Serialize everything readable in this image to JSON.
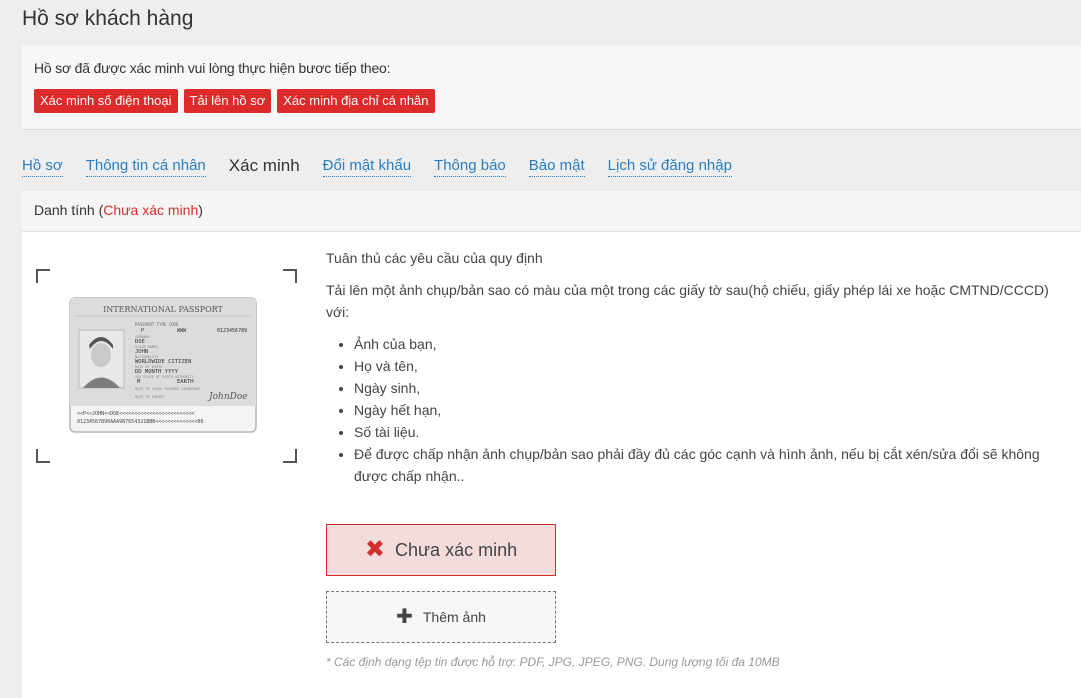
{
  "page": {
    "title": "Hồ sơ khách hàng"
  },
  "notice": {
    "text": "Hồ sơ đã được xác minh vui lòng thực hiện bươc tiếp theo:",
    "buttons": [
      {
        "label": "Xác minh số điện thoại"
      },
      {
        "label": "Tải lên hồ sơ"
      },
      {
        "label": "Xác minh địa chỉ cá nhân"
      }
    ]
  },
  "tabs": [
    {
      "label": "Hồ sơ"
    },
    {
      "label": "Thông tin cá nhân"
    },
    {
      "label": "Xác minh",
      "active": true
    },
    {
      "label": "Đổi mật khẩu"
    },
    {
      "label": "Thông báo"
    },
    {
      "label": "Bảo mật"
    },
    {
      "label": "Lịch sử đăng nhập"
    }
  ],
  "panel": {
    "header_label": "Danh tính",
    "header_status": "Chưa xác minh"
  },
  "passport": {
    "title": "INTERNATIONAL PASSPORT",
    "surname": "DOE",
    "given_name": "JOHN",
    "nationality": "WORLDWIDE CITIZEN",
    "dob": "DD MONTH YYYY",
    "sex": "M",
    "place_of_birth": "EARTH",
    "code": "WWW",
    "number": "0123456789",
    "signature": "JohnDoe",
    "mrz1": "<<P<<JOHN<<DOE<<<<<<<<<<<<<<<<<<<<<<<<<",
    "mrz2": "01234567890AAA987654321BBB<<<<<<<<<<<<<<00"
  },
  "requirements": {
    "title": "Tuân thủ các yêu cầu của quy định",
    "desc": "Tải lên một ảnh chụp/bản sao có màu của một trong các giấy tờ sau(hộ chiếu, giấy phép lái xe hoặc CMTND/CCCD) với:",
    "items": [
      "Ảnh của bạn,",
      "Họ và tên,",
      "Ngày sinh,",
      "Ngày hết hạn,",
      "Số tài liệu.",
      "Để được chấp nhận ảnh chụp/bản sao phải đầy đủ các góc cạnh và hình ảnh, nếu bị cắt xén/sửa đổi sẽ không được chấp nhận.."
    ]
  },
  "status": {
    "label": "Chưa xác minh",
    "icon": "x-icon",
    "color": "#d23030"
  },
  "add_photo": {
    "label": "Thêm ảnh",
    "icon": "plus-icon"
  },
  "footnote": "* Các định dạng tệp tin được hỗ trợ: PDF, JPG, JPEG, PNG. Dung lượng tối đa 10MB"
}
